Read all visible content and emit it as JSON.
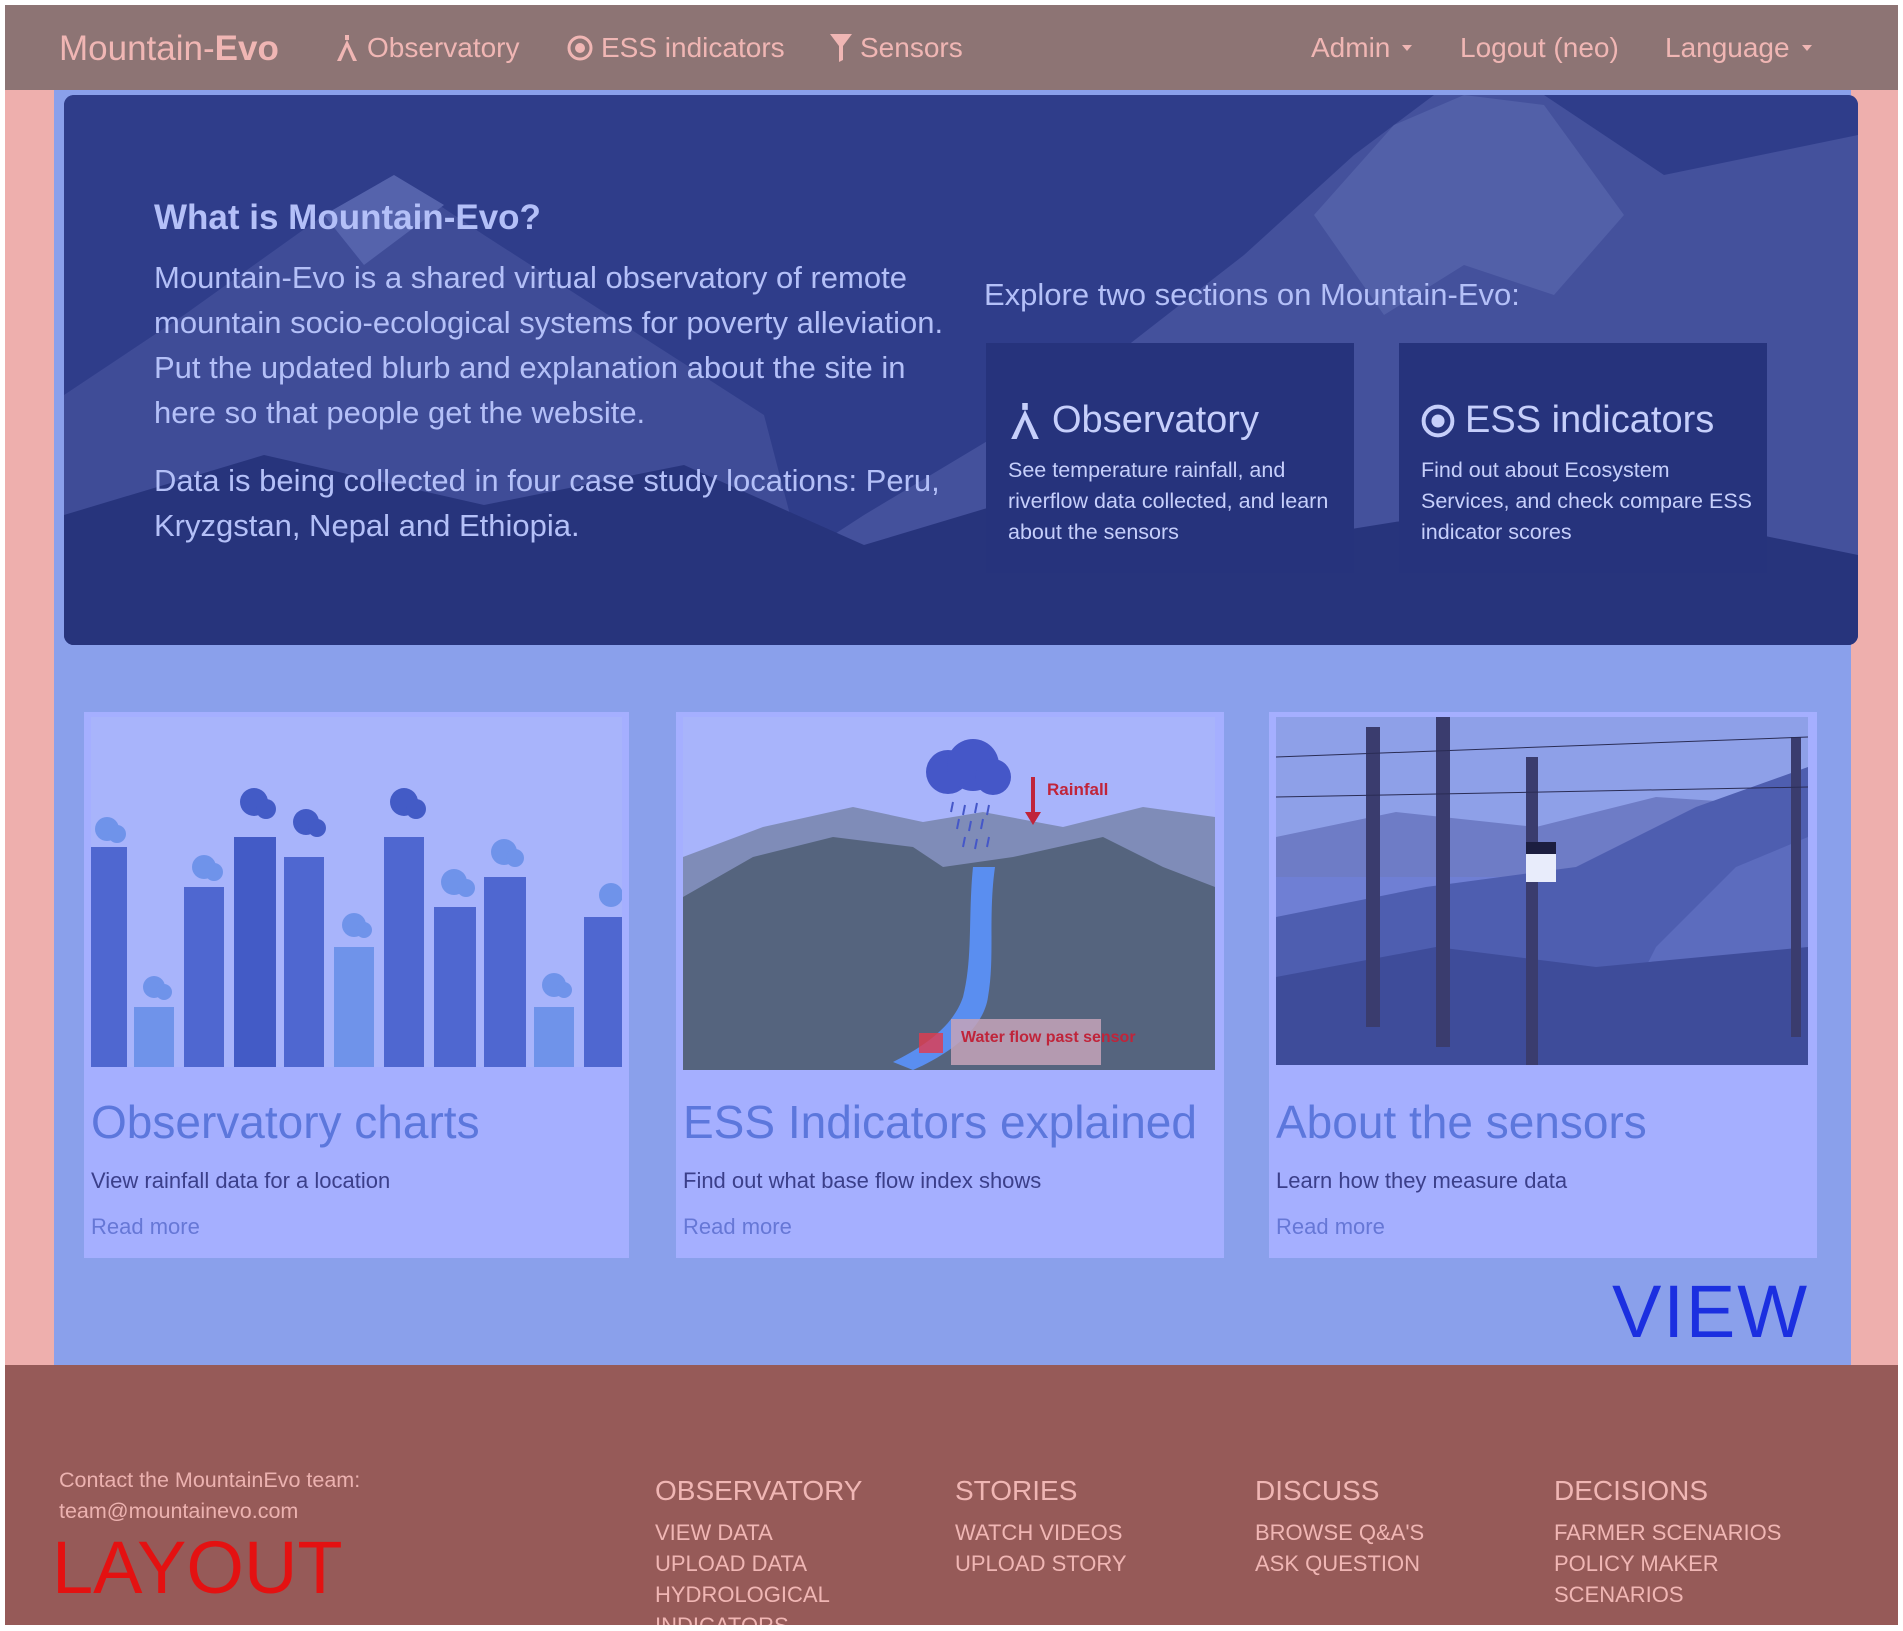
{
  "nav": {
    "brand_prefix": "Mountain-",
    "brand_bold": "Evo",
    "links": [
      {
        "label": "Observatory",
        "icon": "observatory-icon"
      },
      {
        "label": "ESS indicators",
        "icon": "target-icon"
      },
      {
        "label": "Sensors",
        "icon": "funnel-icon"
      }
    ],
    "right": [
      {
        "label": "Admin"
      },
      {
        "label": "Logout (neo)"
      },
      {
        "label": "Language"
      }
    ]
  },
  "hero": {
    "title": "What is Mountain-Evo?",
    "paragraph1": "Mountain-Evo is a shared virtual observatory of remote mountain socio-ecological systems for poverty alleviation. Put the updated blurb and explanation about the site in here so that people get the website.",
    "paragraph2": "Data is being collected in four case study locations: Peru, Kryzgstan, Nepal and Ethiopia.",
    "explore_heading": "Explore two sections on Mountain-Evo:",
    "sections": [
      {
        "title": "Observatory",
        "icon": "observatory-icon",
        "description": "See temperature rainfall, and riverflow data collected, and learn about the sensors"
      },
      {
        "title": "ESS indicators",
        "icon": "target-icon",
        "description": "Find out about Ecosystem Services, and check compare ESS indicator scores"
      }
    ]
  },
  "cards": [
    {
      "title": "Observatory charts",
      "description": "View rainfall data for a location",
      "link": "Read more"
    },
    {
      "title": "ESS Indicators explained",
      "description": "Find out what base flow index shows",
      "link": "Read more",
      "figure_labels": {
        "rainfall": "Rainfall",
        "water_flow": "Water flow past sensor"
      }
    },
    {
      "title": "About the sensors",
      "description": "Learn how they measure data",
      "link": "Read more"
    }
  ],
  "view_label": "VIEW",
  "layout_label": "LAYOUT",
  "footer": {
    "contact_line1": "Contact the MountainEvo team:",
    "contact_email": "team@mountainevo.com",
    "columns": [
      {
        "heading": "OBSERVATORY",
        "items": [
          "VIEW DATA",
          "UPLOAD DATA",
          "HYDROLOGICAL INDICATORS"
        ]
      },
      {
        "heading": "STORIES",
        "items": [
          "WATCH VIDEOS",
          "UPLOAD STORY"
        ]
      },
      {
        "heading": "DISCUSS",
        "items": [
          "BROWSE Q&A'S",
          "ASK QUESTION"
        ]
      },
      {
        "heading": "DECISIONS",
        "items": [
          "FARMER SCENARIOS",
          "POLICY MAKER SCENARIOS"
        ]
      }
    ]
  },
  "colors": {
    "navbar": "#8d7474",
    "hero": "#2d3b86",
    "view_overlay": "#8aa0eb",
    "footer": "#965a58",
    "layout_frame": "#eeafad"
  }
}
